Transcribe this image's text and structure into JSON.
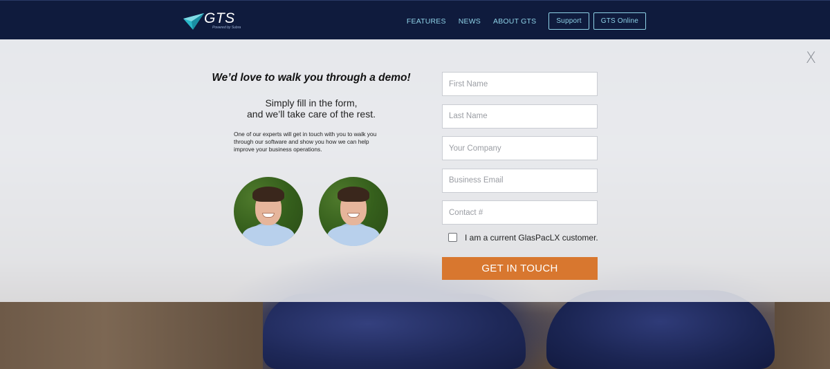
{
  "header": {
    "logo_text": "GTS",
    "logo_sub": "Powered by Subra",
    "nav": [
      {
        "label": "FEATURES"
      },
      {
        "label": "NEWS"
      },
      {
        "label": "ABOUT GTS"
      }
    ],
    "buttons": [
      {
        "label": "Support"
      },
      {
        "label": "GTS Online"
      }
    ]
  },
  "modal": {
    "close_label": "X",
    "headline": "We’d love to walk you through a demo!",
    "sub_line1": "Simply fill in the form,",
    "sub_line2": "and we’ll take care of the rest.",
    "description": "One of our experts will get in touch with you to walk you through our software and show you how we can help improve your business operations.",
    "form": {
      "first_name_placeholder": "First Name",
      "last_name_placeholder": "Last Name",
      "company_placeholder": "Your Company",
      "email_placeholder": "Business Email",
      "contact_placeholder": "Contact #",
      "checkbox_label": "I am a current GlasPacLX customer.",
      "checkbox_checked": false,
      "submit_label": "GET IN TOUCH"
    }
  },
  "colors": {
    "header_bg": "#0f1b3d",
    "nav_text": "#8fd3e8",
    "cta_bg": "#d8772f",
    "overlay_bg": "#e9eaed"
  },
  "icons": {
    "logo": "paper-plane-logo-icon",
    "close": "close-icon"
  }
}
